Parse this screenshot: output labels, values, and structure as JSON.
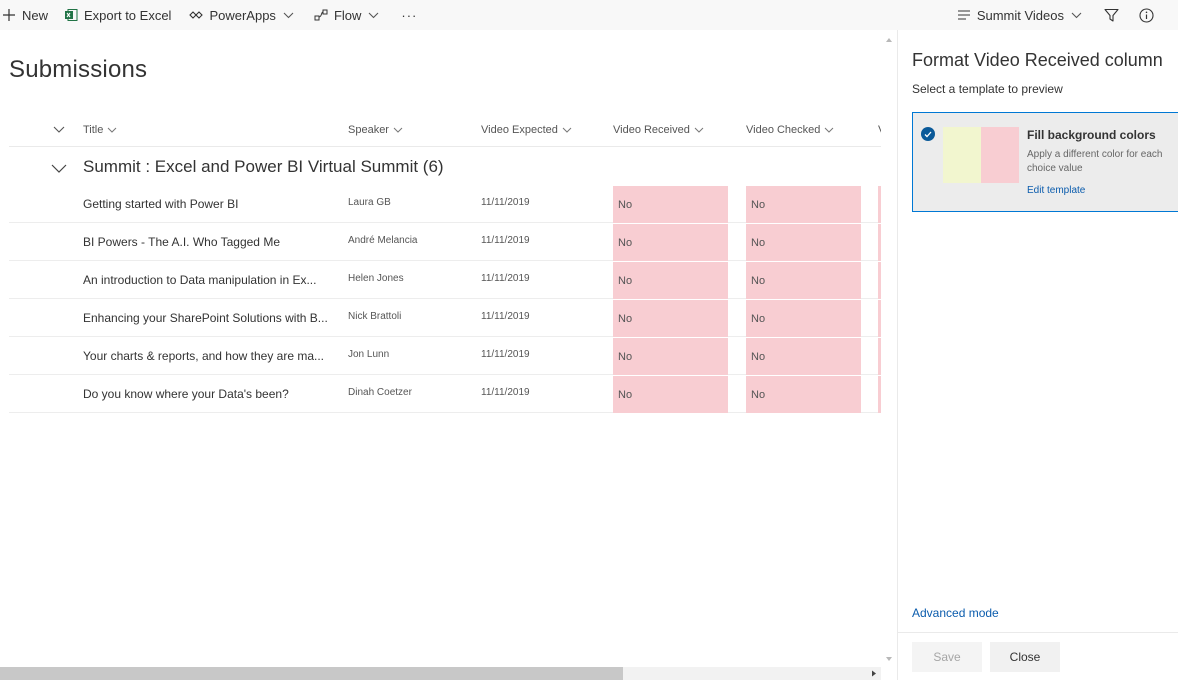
{
  "commandbar": {
    "new_label": "New",
    "export_label": "Export to Excel",
    "powerapps_label": "PowerApps",
    "flow_label": "Flow",
    "more_label": "···",
    "view_label": "Summit Videos"
  },
  "list": {
    "title": "Submissions",
    "columns": {
      "title": "Title",
      "speaker": "Speaker",
      "expected": "Video Expected",
      "received": "Video Received",
      "checked": "Video Checked",
      "partial": "V"
    },
    "group": "Summit : Excel and Power BI Virtual Summit (6)",
    "rows": [
      {
        "title": "Getting started with Power BI",
        "speaker": "Laura GB",
        "expected": "11/11/2019",
        "received": "No",
        "checked": "No"
      },
      {
        "title": "BI Powers - The A.I. Who Tagged Me",
        "speaker": "André Melancia",
        "expected": "11/11/2019",
        "received": "No",
        "checked": "No"
      },
      {
        "title": "An introduction to Data manipulation in Ex...",
        "speaker": "Helen Jones",
        "expected": "11/11/2019",
        "received": "No",
        "checked": "No"
      },
      {
        "title": "Enhancing your SharePoint Solutions with B...",
        "speaker": "Nick Brattoli",
        "expected": "11/11/2019",
        "received": "No",
        "checked": "No"
      },
      {
        "title": "Your charts & reports, and how they are ma...",
        "speaker": "Jon Lunn",
        "expected": "11/11/2019",
        "received": "No",
        "checked": "No"
      },
      {
        "title": "Do you know where your Data's been?",
        "speaker": "Dinah Coetzer",
        "expected": "11/11/2019",
        "received": "No",
        "checked": "No"
      }
    ]
  },
  "panel": {
    "title": "Format Video Received column",
    "subtitle": "Select a template to preview",
    "template_name": "Fill background colors",
    "template_desc": "Apply a different color for each choice value",
    "edit_template": "Edit template",
    "advanced": "Advanced mode",
    "save_label": "Save",
    "close_label": "Close"
  },
  "colors": {
    "accent": "#0078d4",
    "pink_fill": "#f8cdd2",
    "yellow_fill": "#f2f6cf"
  }
}
